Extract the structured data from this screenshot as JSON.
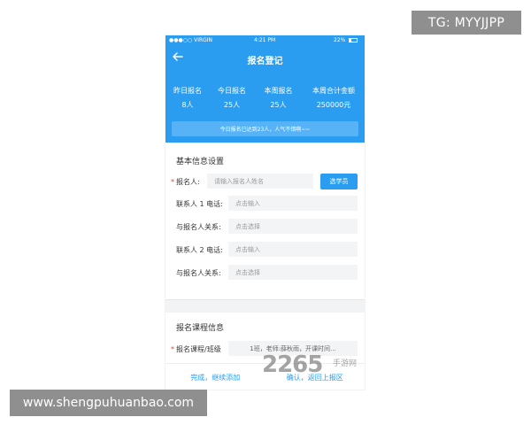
{
  "badges": {
    "tg": "TG: MYYJJPP",
    "site": "www.shengpuhuanbao.com"
  },
  "status_bar": {
    "carrier": "●●●○○ VIRGIN",
    "time": "4:21 PM",
    "battery": "22%"
  },
  "nav": {
    "title": "报名登记",
    "back_icon": "arrow-left-icon"
  },
  "stats": [
    {
      "label": "昨日报名",
      "value": "8人"
    },
    {
      "label": "今日报名",
      "value": "25人"
    },
    {
      "label": "本周报名",
      "value": "25人"
    },
    {
      "label": "本周合计金额",
      "value": "250000元"
    }
  ],
  "notice": "今日报名已达到23人，人气不错啊~~",
  "basic_info": {
    "title": "基本信息设置",
    "rows": [
      {
        "label": "报名人:",
        "required": "*",
        "placeholder": "请输入报名人姓名"
      },
      {
        "label": "联系人 1 电话:",
        "placeholder": "点击输入"
      },
      {
        "label": "与报名人关系:",
        "placeholder": "点击选择"
      },
      {
        "label": "联系人 2 电话:",
        "placeholder": "点击输入"
      },
      {
        "label": "与报名人关系:",
        "placeholder": "点击选择"
      }
    ],
    "pick_button": "选学员"
  },
  "course_info": {
    "title": "报名课程信息",
    "row": {
      "required": "*",
      "label": "报名课程/班级",
      "value": "1班，老师:薛秋雨，开课时间..."
    }
  },
  "bottom_bar": {
    "left": "完成，继续添加",
    "right": "确认，返回上报区"
  },
  "watermark": {
    "number": "2265",
    "tag": "手游网"
  },
  "colors": {
    "primary": "#2b9df1",
    "required": "#e64340",
    "badge_bg": "#8f8f8f"
  }
}
